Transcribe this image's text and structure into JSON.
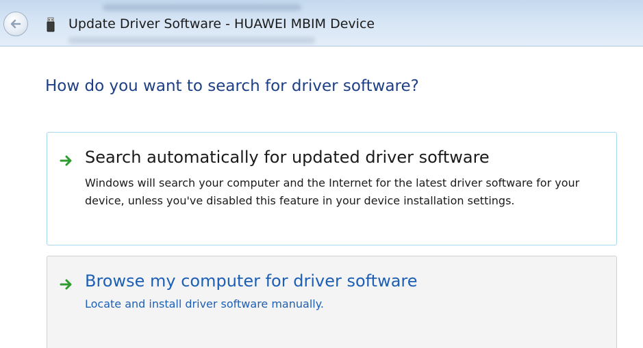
{
  "window": {
    "title": "Update Driver Software - HUAWEI MBIM Device",
    "back_icon": "back-arrow-icon",
    "device_icon": "usb-device-icon"
  },
  "main": {
    "heading": "How do you want to search for driver software?"
  },
  "options": [
    {
      "icon": "green-arrow-icon",
      "title": "Search automatically for updated driver software",
      "description": "Windows will search your computer and the Internet for the latest driver software for your device, unless you've disabled this feature in your device installation settings."
    },
    {
      "icon": "green-arrow-icon",
      "title": "Browse my computer for driver software",
      "description": "Locate and install driver software manually."
    }
  ],
  "colors": {
    "heading": "#1d3f86",
    "link": "#1c5fb5",
    "arrow": "#2d9b2d",
    "selected_border": "#a8d8ec"
  }
}
